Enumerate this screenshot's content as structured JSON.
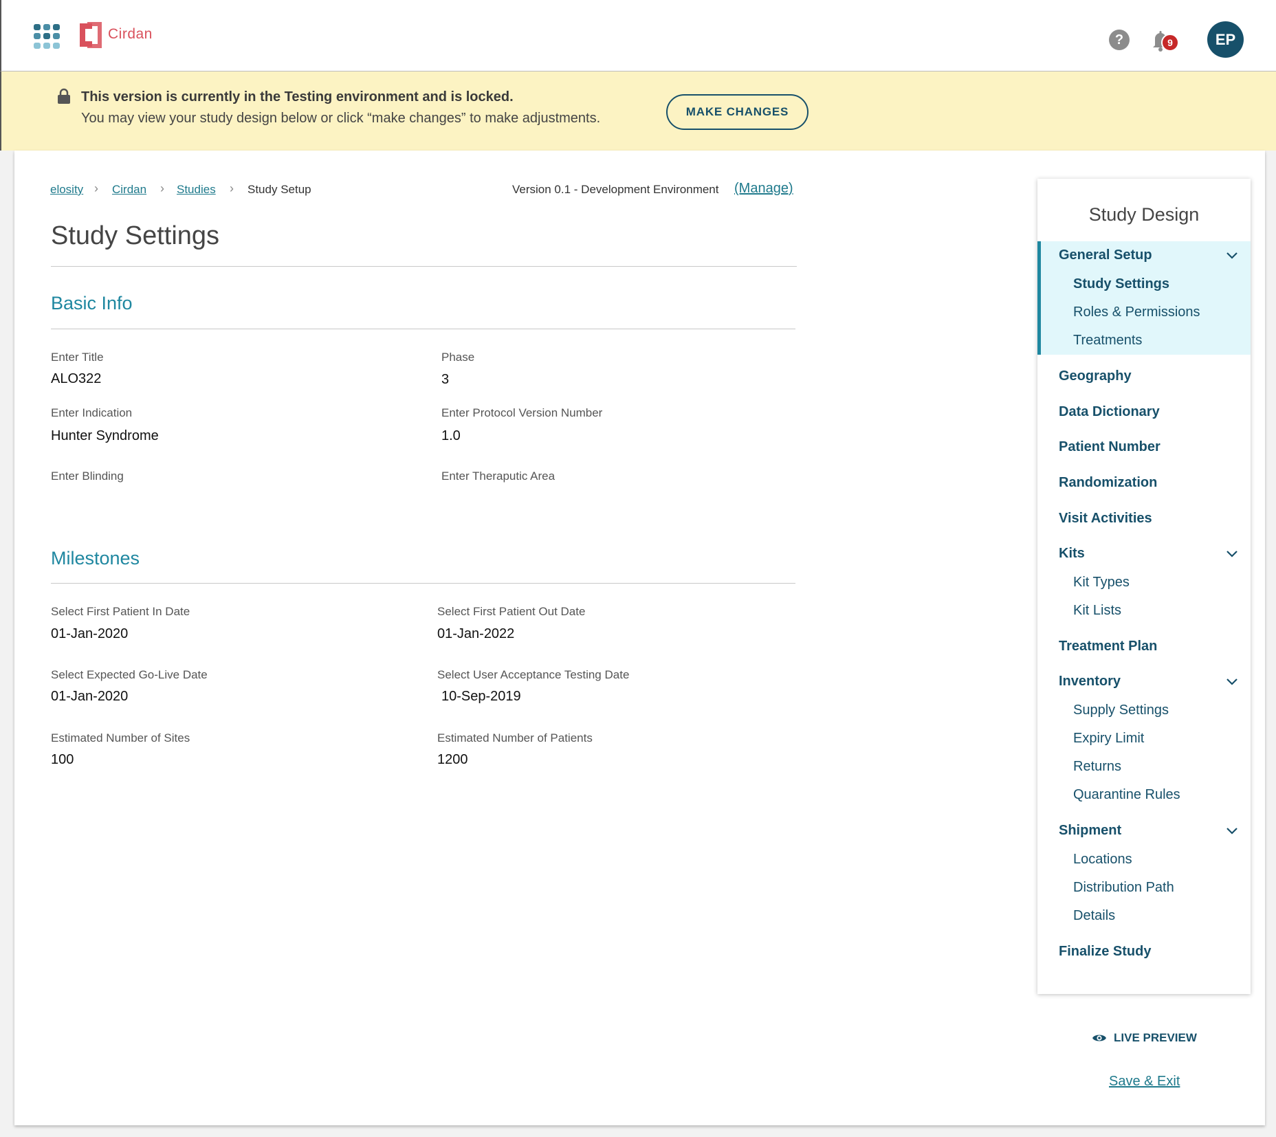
{
  "header": {
    "brand_name": "Cirdan",
    "help_icon_glyph": "?",
    "notification_count": "9",
    "avatar_initials": "EP"
  },
  "banner": {
    "title": "This version is currently in the Testing environment and is locked.",
    "subtitle": "You may view your study design below or click “make changes” to make adjustments.",
    "button_label": "MAKE CHANGES"
  },
  "breadcrumb": {
    "items": [
      "elosity",
      "Cirdan",
      "Studies",
      "Study Setup"
    ]
  },
  "version": {
    "text": "Version 0.1 - Development Environment",
    "manage_label": "(Manage)"
  },
  "page_title": "Study Settings",
  "basic_info": {
    "title": "Basic Info",
    "fields": [
      {
        "label": "Enter Title",
        "value": "ALO322"
      },
      {
        "label": "Phase",
        "value": "3"
      },
      {
        "label": "Enter Indication",
        "value": "Hunter Syndrome"
      },
      {
        "label": "Enter Protocol Version Number",
        "value": "1.0"
      },
      {
        "label": "Enter Blinding",
        "value": ""
      },
      {
        "label": "Enter Theraputic Area",
        "value": ""
      }
    ]
  },
  "milestones": {
    "title": "Milestones",
    "fields": [
      {
        "label": "Select First Patient In Date",
        "value": "01-Jan-2020"
      },
      {
        "label": "Select First Patient Out Date",
        "value": "01-Jan-2022"
      },
      {
        "label": "Select Expected Go-Live Date",
        "value": "01-Jan-2020"
      },
      {
        "label": "Select User Acceptance Testing Date",
        "value": "10-Sep-2019"
      },
      {
        "label": "Estimated Number of Sites",
        "value": "100"
      },
      {
        "label": "Estimated Number of Patients",
        "value": "1200"
      }
    ]
  },
  "nav": {
    "title": "Study Design",
    "items": [
      {
        "label": "General Setup",
        "subs": [
          "Study Settings",
          "Roles & Permissions",
          "Treatments"
        ]
      },
      {
        "label": "Geography"
      },
      {
        "label": "Data Dictionary"
      },
      {
        "label": "Patient Number"
      },
      {
        "label": "Randomization"
      },
      {
        "label": "Visit Activities"
      },
      {
        "label": "Kits",
        "subs": [
          "Kit Types",
          "Kit Lists"
        ]
      },
      {
        "label": "Treatment Plan"
      },
      {
        "label": "Inventory",
        "subs": [
          "Supply Settings",
          "Expiry Limit",
          "Returns",
          "Quarantine Rules"
        ]
      },
      {
        "label": "Shipment",
        "subs": [
          "Locations",
          "Distribution Path",
          "Details"
        ]
      },
      {
        "label": "Finalize Study"
      }
    ]
  },
  "footer": {
    "live_preview_label": "LIVE PREVIEW",
    "save_exit_label": "Save & Exit"
  },
  "colors": {
    "brand": "#d9515c",
    "primary": "#17506a",
    "accent": "#1f87a0",
    "banner_bg": "#fcf3c3",
    "nav_highlight": "#e1f7fb",
    "badge": "#c62828"
  }
}
